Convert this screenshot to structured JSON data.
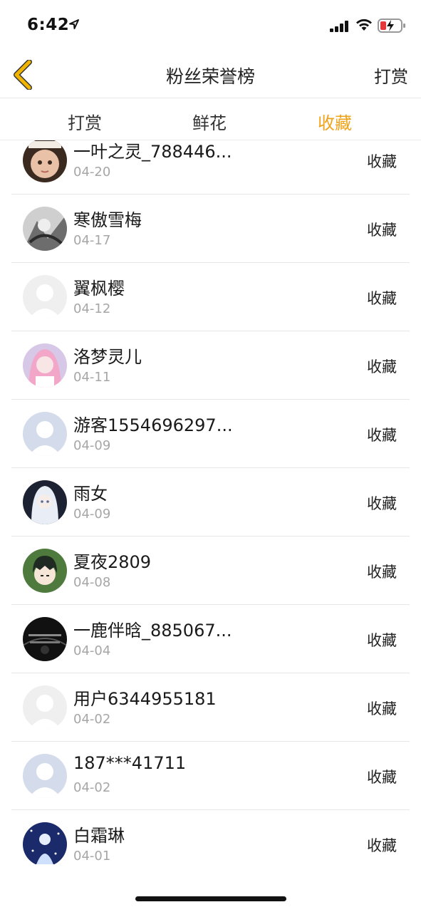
{
  "status_bar": {
    "time": "6:42"
  },
  "nav": {
    "title": "粉丝荣誉榜",
    "right_action": "打赏"
  },
  "tabs": [
    {
      "label": "打赏",
      "active": false
    },
    {
      "label": "鲜花",
      "active": false
    },
    {
      "label": "收藏",
      "active": true
    }
  ],
  "colors": {
    "accent": "#f0a31a",
    "back_icon": "#f0b400",
    "date_text": "#a6a6a6",
    "divider": "#e6e6e6"
  },
  "list": {
    "items": [
      {
        "name": "一叶之灵_788446...",
        "date": "04-20",
        "action": "收藏",
        "avatar": "girl-portrait"
      },
      {
        "name": "寒傲雪梅",
        "date": "04-17",
        "action": "收藏",
        "avatar": "ink-art"
      },
      {
        "name": "翼枫樱",
        "date": "04-12",
        "action": "收藏",
        "avatar": "default-gray"
      },
      {
        "name": "洛梦灵儿",
        "date": "04-11",
        "action": "收藏",
        "avatar": "anime-pink"
      },
      {
        "name": "游客1554696297...",
        "date": "04-09",
        "action": "收藏",
        "avatar": "default-blue"
      },
      {
        "name": "雨女",
        "date": "04-09",
        "action": "收藏",
        "avatar": "anime-white"
      },
      {
        "name": "夏夜2809",
        "date": "04-08",
        "action": "收藏",
        "avatar": "anime-boy"
      },
      {
        "name": "一鹿伴晗_885067...",
        "date": "04-04",
        "action": "收藏",
        "avatar": "dark-text"
      },
      {
        "name": "用户6344955181",
        "date": "04-02",
        "action": "收藏",
        "avatar": "default-gray"
      },
      {
        "name": "187***41711",
        "date": "04-02",
        "action": "收藏",
        "avatar": "default-blue"
      },
      {
        "name": "白霜琳",
        "date": "04-01",
        "action": "收藏",
        "avatar": "snow-art"
      }
    ]
  }
}
